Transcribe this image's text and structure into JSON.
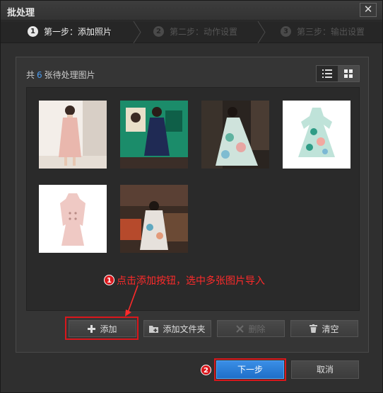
{
  "window": {
    "title": "批处理",
    "close_glyph": "✕"
  },
  "steps": [
    {
      "num": "1",
      "label": "第一步：添加照片",
      "state": "active"
    },
    {
      "num": "2",
      "label": "第二步：动作设置",
      "state": "inactive"
    },
    {
      "num": "3",
      "label": "第三步：输出设置",
      "state": "inactive"
    }
  ],
  "panel": {
    "count_prefix": "共",
    "count_value": "6",
    "count_suffix": "张待处理图片",
    "views": [
      "list-view-icon",
      "grid-view-icon"
    ],
    "active_view": "grid"
  },
  "thumbnails": [
    {
      "name": "photo-1",
      "desc": "woman in pink coat"
    },
    {
      "name": "photo-2",
      "desc": "woman in navy dress"
    },
    {
      "name": "photo-3",
      "desc": "woman in floral gown"
    },
    {
      "name": "photo-4",
      "desc": "teal floral dress"
    },
    {
      "name": "photo-5",
      "desc": "pink coat product"
    },
    {
      "name": "photo-6",
      "desc": "woman seated indoors"
    }
  ],
  "actions": {
    "add": "添加",
    "add_folder": "添加文件夹",
    "delete": "删除",
    "clear": "清空"
  },
  "annotations": {
    "badge_1": "1",
    "text_1": "点击添加按钮，选中多张图片导入",
    "badge_2": "2"
  },
  "footer": {
    "next": "下一步",
    "cancel": "取消"
  },
  "colors": {
    "accent": "#2a7fd8",
    "annotation": "#d9171c",
    "count_number": "#4a9bf0"
  }
}
